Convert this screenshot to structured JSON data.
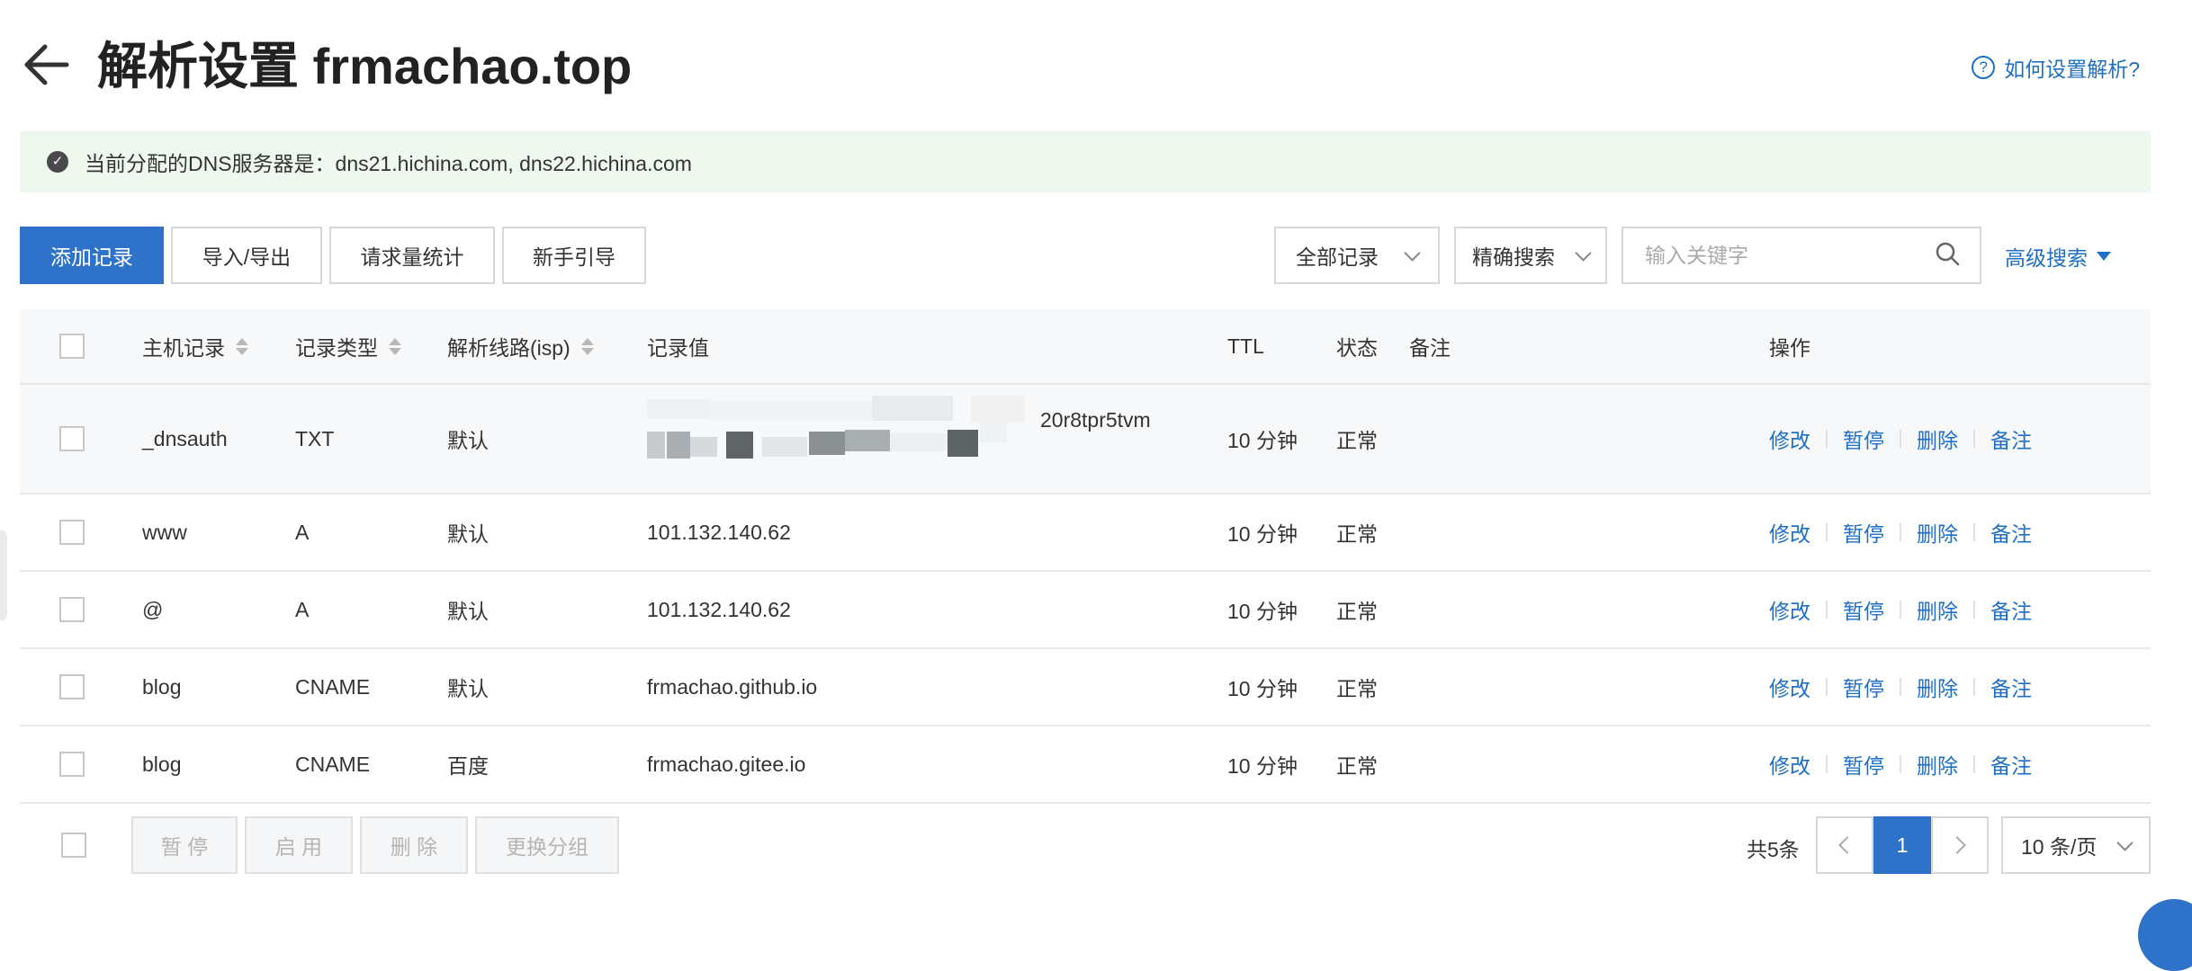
{
  "header": {
    "title": "解析设置 frmachao.top",
    "help_link": "如何设置解析?",
    "help_icon": "?"
  },
  "notice": {
    "text": "当前分配的DNS服务器是：dns21.hichina.com, dns22.hichina.com"
  },
  "toolbar": {
    "add_record": "添加记录",
    "import_export": "导入/导出",
    "request_stats": "请求量统计",
    "beginner_guide": "新手引导",
    "record_filter": "全部记录",
    "search_mode": "精确搜索",
    "search_placeholder": "输入关键字",
    "advanced_search": "高级搜索"
  },
  "table": {
    "columns": {
      "host": "主机记录",
      "type": "记录类型",
      "line": "解析线路(isp)",
      "value": "记录值",
      "ttl": "TTL",
      "status": "状态",
      "remark": "备注",
      "actions": "操作"
    },
    "actions": {
      "edit": "修改",
      "pause": "暂停",
      "delete": "删除",
      "remark": "备注"
    },
    "rows": [
      {
        "host": "_dnsauth",
        "type": "TXT",
        "line": "默认",
        "value": "20r8tpr5tvm",
        "ttl": "10 分钟",
        "status": "正常"
      },
      {
        "host": "www",
        "type": "A",
        "line": "默认",
        "value": "101.132.140.62",
        "ttl": "10 分钟",
        "status": "正常"
      },
      {
        "host": "@",
        "type": "A",
        "line": "默认",
        "value": "101.132.140.62",
        "ttl": "10 分钟",
        "status": "正常"
      },
      {
        "host": "blog",
        "type": "CNAME",
        "line": "默认",
        "value": "frmachao.github.io",
        "ttl": "10 分钟",
        "status": "正常"
      },
      {
        "host": "blog",
        "type": "CNAME",
        "line": "百度",
        "value": "frmachao.gitee.io",
        "ttl": "10 分钟",
        "status": "正常"
      }
    ]
  },
  "footer": {
    "batch_pause": "暂 停",
    "batch_enable": "启 用",
    "batch_delete": "删 除",
    "change_group": "更换分组",
    "total": "共5条",
    "current_page": "1",
    "page_size": "10 条/页"
  },
  "colors": {
    "primary": "#2f72c9",
    "link": "#1f6fc5",
    "notice_bg": "#eef8ef"
  }
}
